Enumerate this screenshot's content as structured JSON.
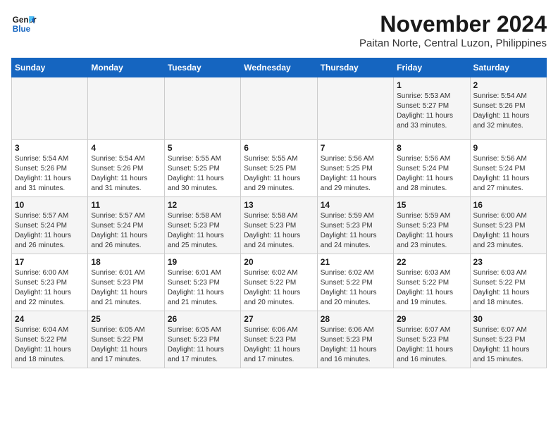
{
  "logo": {
    "line1": "General",
    "line2": "Blue"
  },
  "title": "November 2024",
  "subtitle": "Paitan Norte, Central Luzon, Philippines",
  "headers": [
    "Sunday",
    "Monday",
    "Tuesday",
    "Wednesday",
    "Thursday",
    "Friday",
    "Saturday"
  ],
  "weeks": [
    [
      {
        "day": "",
        "info": ""
      },
      {
        "day": "",
        "info": ""
      },
      {
        "day": "",
        "info": ""
      },
      {
        "day": "",
        "info": ""
      },
      {
        "day": "",
        "info": ""
      },
      {
        "day": "1",
        "info": "Sunrise: 5:53 AM\nSunset: 5:27 PM\nDaylight: 11 hours\nand 33 minutes."
      },
      {
        "day": "2",
        "info": "Sunrise: 5:54 AM\nSunset: 5:26 PM\nDaylight: 11 hours\nand 32 minutes."
      }
    ],
    [
      {
        "day": "3",
        "info": "Sunrise: 5:54 AM\nSunset: 5:26 PM\nDaylight: 11 hours\nand 31 minutes."
      },
      {
        "day": "4",
        "info": "Sunrise: 5:54 AM\nSunset: 5:26 PM\nDaylight: 11 hours\nand 31 minutes."
      },
      {
        "day": "5",
        "info": "Sunrise: 5:55 AM\nSunset: 5:25 PM\nDaylight: 11 hours\nand 30 minutes."
      },
      {
        "day": "6",
        "info": "Sunrise: 5:55 AM\nSunset: 5:25 PM\nDaylight: 11 hours\nand 29 minutes."
      },
      {
        "day": "7",
        "info": "Sunrise: 5:56 AM\nSunset: 5:25 PM\nDaylight: 11 hours\nand 29 minutes."
      },
      {
        "day": "8",
        "info": "Sunrise: 5:56 AM\nSunset: 5:24 PM\nDaylight: 11 hours\nand 28 minutes."
      },
      {
        "day": "9",
        "info": "Sunrise: 5:56 AM\nSunset: 5:24 PM\nDaylight: 11 hours\nand 27 minutes."
      }
    ],
    [
      {
        "day": "10",
        "info": "Sunrise: 5:57 AM\nSunset: 5:24 PM\nDaylight: 11 hours\nand 26 minutes."
      },
      {
        "day": "11",
        "info": "Sunrise: 5:57 AM\nSunset: 5:24 PM\nDaylight: 11 hours\nand 26 minutes."
      },
      {
        "day": "12",
        "info": "Sunrise: 5:58 AM\nSunset: 5:23 PM\nDaylight: 11 hours\nand 25 minutes."
      },
      {
        "day": "13",
        "info": "Sunrise: 5:58 AM\nSunset: 5:23 PM\nDaylight: 11 hours\nand 24 minutes."
      },
      {
        "day": "14",
        "info": "Sunrise: 5:59 AM\nSunset: 5:23 PM\nDaylight: 11 hours\nand 24 minutes."
      },
      {
        "day": "15",
        "info": "Sunrise: 5:59 AM\nSunset: 5:23 PM\nDaylight: 11 hours\nand 23 minutes."
      },
      {
        "day": "16",
        "info": "Sunrise: 6:00 AM\nSunset: 5:23 PM\nDaylight: 11 hours\nand 23 minutes."
      }
    ],
    [
      {
        "day": "17",
        "info": "Sunrise: 6:00 AM\nSunset: 5:23 PM\nDaylight: 11 hours\nand 22 minutes."
      },
      {
        "day": "18",
        "info": "Sunrise: 6:01 AM\nSunset: 5:23 PM\nDaylight: 11 hours\nand 21 minutes."
      },
      {
        "day": "19",
        "info": "Sunrise: 6:01 AM\nSunset: 5:23 PM\nDaylight: 11 hours\nand 21 minutes."
      },
      {
        "day": "20",
        "info": "Sunrise: 6:02 AM\nSunset: 5:22 PM\nDaylight: 11 hours\nand 20 minutes."
      },
      {
        "day": "21",
        "info": "Sunrise: 6:02 AM\nSunset: 5:22 PM\nDaylight: 11 hours\nand 20 minutes."
      },
      {
        "day": "22",
        "info": "Sunrise: 6:03 AM\nSunset: 5:22 PM\nDaylight: 11 hours\nand 19 minutes."
      },
      {
        "day": "23",
        "info": "Sunrise: 6:03 AM\nSunset: 5:22 PM\nDaylight: 11 hours\nand 18 minutes."
      }
    ],
    [
      {
        "day": "24",
        "info": "Sunrise: 6:04 AM\nSunset: 5:22 PM\nDaylight: 11 hours\nand 18 minutes."
      },
      {
        "day": "25",
        "info": "Sunrise: 6:05 AM\nSunset: 5:22 PM\nDaylight: 11 hours\nand 17 minutes."
      },
      {
        "day": "26",
        "info": "Sunrise: 6:05 AM\nSunset: 5:23 PM\nDaylight: 11 hours\nand 17 minutes."
      },
      {
        "day": "27",
        "info": "Sunrise: 6:06 AM\nSunset: 5:23 PM\nDaylight: 11 hours\nand 17 minutes."
      },
      {
        "day": "28",
        "info": "Sunrise: 6:06 AM\nSunset: 5:23 PM\nDaylight: 11 hours\nand 16 minutes."
      },
      {
        "day": "29",
        "info": "Sunrise: 6:07 AM\nSunset: 5:23 PM\nDaylight: 11 hours\nand 16 minutes."
      },
      {
        "day": "30",
        "info": "Sunrise: 6:07 AM\nSunset: 5:23 PM\nDaylight: 11 hours\nand 15 minutes."
      }
    ]
  ]
}
